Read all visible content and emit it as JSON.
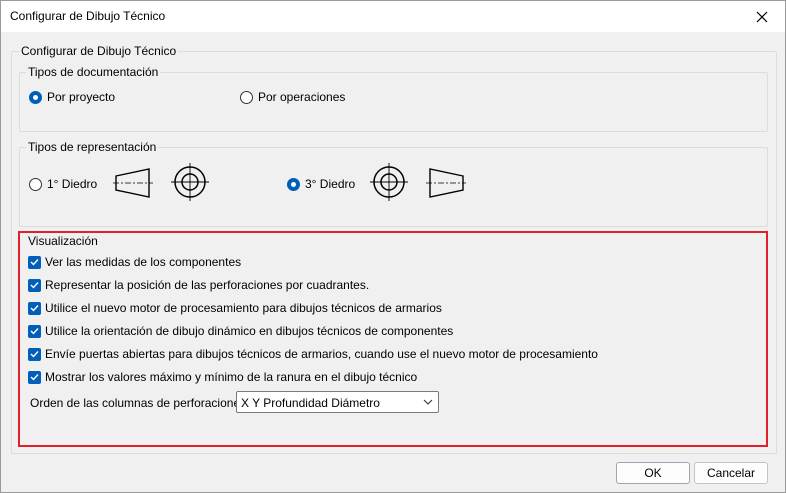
{
  "window": {
    "title": "Configurar de Dibujo Técnico"
  },
  "main_group": {
    "legend": "Configurar de Dibujo Técnico"
  },
  "documentation": {
    "legend": "Tipos de documentación",
    "options": [
      {
        "label": "Por proyecto",
        "checked": true
      },
      {
        "label": "Por operaciones",
        "checked": false
      }
    ]
  },
  "representation": {
    "legend": "Tipos de representación",
    "options": [
      {
        "label": "1° Diedro",
        "checked": false
      },
      {
        "label": "3° Diedro",
        "checked": true
      }
    ]
  },
  "visualization": {
    "legend": "Visualización",
    "checkboxes": [
      {
        "label": "Ver las medidas de los componentes",
        "checked": true
      },
      {
        "label": "Representar la posición de las perforaciones por cuadrantes.",
        "checked": true
      },
      {
        "label": "Utilice el nuevo motor de procesamiento para dibujos técnicos de armarios",
        "checked": true
      },
      {
        "label": "Utilice la orientación de dibujo dinámico en dibujos técnicos de componentes",
        "checked": true
      },
      {
        "label": "Envíe puertas abiertas para dibujos técnicos de armarios, cuando use el nuevo motor de procesamiento",
        "checked": true
      },
      {
        "label": "Mostrar los valores máximo y mínimo de la ranura en el dibujo técnico",
        "checked": true
      }
    ],
    "hole_order": {
      "label": "Orden de las columnas de perforaciones",
      "value": "X Y Profundidad Diámetro"
    }
  },
  "buttons": {
    "ok": "OK",
    "cancel": "Cancelar"
  },
  "colors": {
    "accent": "#005fb8",
    "highlight": "#e0202a"
  }
}
